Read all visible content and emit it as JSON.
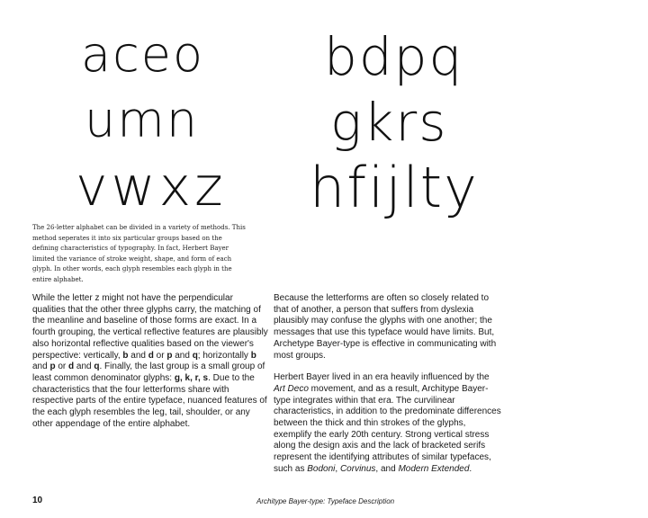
{
  "glyph_groups": {
    "left": [
      "aceo",
      "umn",
      "vwxz"
    ],
    "right": [
      "bdpq",
      "gkrs",
      "hfijlty"
    ]
  },
  "caption": "The 26-letter alphabet can be divided in a variety of methods. This method seperates it into six particular groups based on the defining characteristics of typography. In fact, Herbert Bayer limited the variance of stroke weight, shape, and form of each glyph. In other words, each glyph resembles each glyph in the entire alphabet.",
  "body_left": {
    "t1": "While the letter z might not have the perpendicular qualities that the other three glyphs carry, the matching of the meanline and baseline of those forms are exact. In a fourth grouping, the vertical reflective features are plausibly also horizontal reflective qualities based on the viewer's perspective: vertically, ",
    "b1": "b",
    "t2": " and ",
    "b2": "d",
    "t3": " or ",
    "b3": "p",
    "t4": " and ",
    "b4": "q",
    "t5": "; horizontally ",
    "b5": "b",
    "t6": " and ",
    "b6": "p",
    "t7": " or ",
    "b7": "d",
    "t8": " and ",
    "b8": "q",
    "t9": ". Finally, the last group is a small group of least common denominator glyphs: ",
    "b9": "g, k, r, s",
    "t10": ". Due to the characteristics that the four letterforms share with respective parts of the entire typeface, nuanced features of the each glyph resembles the leg, tail, shoulder, or any other appendage of the entire alphabet."
  },
  "body_right": {
    "p1": "Because the letterforms are often so closely related to that of another, a person that suffers from dyslexia plausibly may confuse the glyphs with one another; the messages that use this typeface would have limits. But, Archetype Bayer-type is effective in communicating with most groups.",
    "p2_t1": "Herbert Bayer lived in an era heavily influenced by the ",
    "p2_i1": "Art Deco",
    "p2_t2": " movement, and as a result, Architype Bayer-type integrates within that era. The curvilinear characteristics, in addition to the predominate differences between the thick and thin strokes of the glyphs, exemplify the early 20th century. Strong vertical stress along the design axis and the lack of bracketed serifs represent the identifying attributes of similar typefaces, such as ",
    "p2_i2": "Bodoni",
    "p2_t3": ", ",
    "p2_i3": "Corvinus",
    "p2_t4": ", and ",
    "p2_i4": "Modern Extended",
    "p2_t5": "."
  },
  "footer": {
    "page_number": "10",
    "running_title": "Architype Bayer-type: Typeface Description"
  }
}
